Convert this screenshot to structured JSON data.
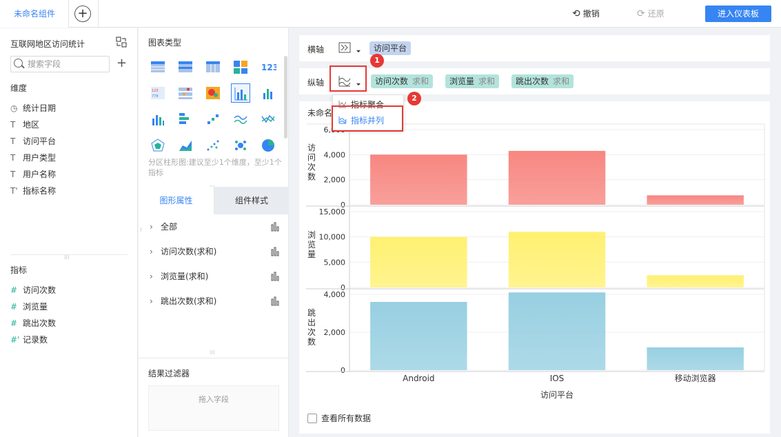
{
  "topbar": {
    "component_tab": "未命名组件",
    "undo_label": "撤销",
    "redo_label": "还原",
    "enter_dashboard_label": "进入仪表板"
  },
  "left_panel": {
    "dataset_title": "互联网地区访问统计",
    "search_placeholder": "搜索字段",
    "dimensions_title": "维度",
    "dimensions": [
      {
        "icon": "clock-icon",
        "label": "统计日期"
      },
      {
        "icon": "text-t-icon",
        "label": "地区"
      },
      {
        "icon": "text-t-icon",
        "label": "访问平台"
      },
      {
        "icon": "text-t-icon",
        "label": "用户类型"
      },
      {
        "icon": "text-t-icon",
        "label": "用户名称"
      },
      {
        "icon": "text-t-icon",
        "label": "指标名称"
      }
    ],
    "measures_title": "指标",
    "measures": [
      {
        "icon": "hash-icon",
        "label": "访问次数"
      },
      {
        "icon": "hash-icon",
        "label": "浏览量"
      },
      {
        "icon": "hash-icon",
        "label": "跳出次数"
      },
      {
        "icon": "hash-icon",
        "label": "记录数"
      }
    ]
  },
  "mid_panel": {
    "chart_type_title": "图表类型",
    "chart_hint": "分区柱形图:建议至少1个维度，至少1个指标",
    "tabs": [
      "图形属性",
      "组件样式"
    ],
    "properties": [
      {
        "label": "全部"
      },
      {
        "label": "访问次数(求和)"
      },
      {
        "label": "浏览量(求和)"
      },
      {
        "label": "跳出次数(求和)"
      }
    ],
    "filter_title": "结果过滤器",
    "filter_drop_hint": "拖入字段"
  },
  "axes": {
    "x_label": "横轴",
    "x_fields": [
      {
        "label": "访问平台"
      }
    ],
    "y_label": "纵轴",
    "y_fields": [
      {
        "label": "访问次数",
        "agg": "求和"
      },
      {
        "label": "浏览量",
        "agg": "求和"
      },
      {
        "label": "跳出次数",
        "agg": "求和"
      }
    ]
  },
  "dropdown": {
    "items": [
      "指标聚合",
      "指标并列"
    ],
    "highlighted": "指标并列"
  },
  "annotations": {
    "badge1": "1",
    "badge2": "2"
  },
  "chart_title": "未命名",
  "view_all_label": "查看所有数据",
  "colors": {
    "accent": "#3685f2",
    "series1": "#f7807a",
    "series2": "#fff06a",
    "series3": "#92cde0",
    "annotation": "#e53935"
  },
  "chart_data": {
    "type": "bar",
    "categories": [
      "Android",
      "IOS",
      "移动浏览器"
    ],
    "xlabel": "访问平台",
    "panels": [
      {
        "ylabel": "访问次数",
        "values": [
          4000,
          4300,
          750
        ],
        "yticks": [
          "0",
          "2,000",
          "4,000",
          "6,000"
        ],
        "ylim": [
          0,
          6000
        ]
      },
      {
        "ylabel": "浏览量",
        "values": [
          10000,
          11000,
          2400
        ],
        "yticks": [
          "0",
          "5,000",
          "10,000",
          "15,000"
        ],
        "ylim": [
          0,
          15000
        ]
      },
      {
        "ylabel": "跳出次数",
        "values": [
          3600,
          4100,
          1200
        ],
        "yticks": [
          "0",
          "2,000",
          "4,000"
        ],
        "ylim": [
          0,
          4000
        ]
      }
    ]
  }
}
